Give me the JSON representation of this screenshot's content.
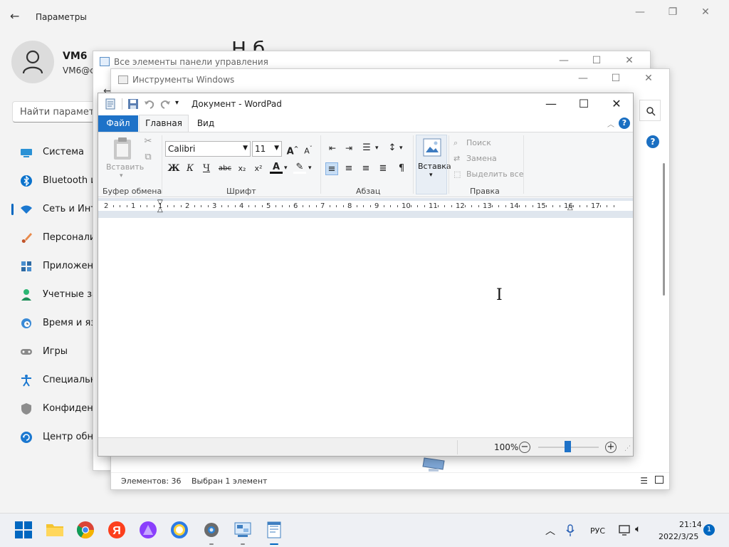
{
  "settings": {
    "title": "Параметры",
    "user_name": "VM6",
    "user_email": "VM6@c",
    "search_placeholder": "Найти параметр",
    "heading": "Н б",
    "nav": [
      {
        "label": "Система",
        "icon": "monitor-icon"
      },
      {
        "label": "Bluetooth и",
        "icon": "bluetooth-icon"
      },
      {
        "label": "Сеть и Инт",
        "icon": "wifi-icon",
        "active": true
      },
      {
        "label": "Персонали",
        "icon": "brush-icon"
      },
      {
        "label": "Приложен",
        "icon": "apps-icon"
      },
      {
        "label": "Учетные за",
        "icon": "person-icon"
      },
      {
        "label": "Время и яз",
        "icon": "clock-globe-icon"
      },
      {
        "label": "Игры",
        "icon": "gamepad-icon"
      },
      {
        "label": "Специальн",
        "icon": "accessibility-icon"
      },
      {
        "label": "Конфиден",
        "icon": "shield-icon"
      },
      {
        "label": "Центр обн",
        "icon": "update-icon"
      }
    ]
  },
  "control_panel": {
    "title": "Все элементы панели управления"
  },
  "windows_tools": {
    "title": "Инструменты Windows",
    "status_items": "Элементов: 36",
    "status_selected": "Выбран 1 элемент"
  },
  "wordpad": {
    "title": "Документ - WordPad",
    "tabs": {
      "file": "Файл",
      "home": "Главная",
      "view": "Вид"
    },
    "clipboard": {
      "paste": "Вставить",
      "group": "Буфер обмена"
    },
    "font": {
      "name": "Calibri",
      "size": "11",
      "group": "Шрифт",
      "bold": "Ж",
      "italic": "К",
      "underline": "Ч",
      "strike": "abc",
      "sub": "x₂",
      "sup": "x²",
      "color": "A"
    },
    "paragraph": {
      "group": "Абзац"
    },
    "insert": {
      "label": "Вставка",
      "group": ""
    },
    "editing": {
      "group": "Правка",
      "find": "Поиск",
      "replace": "Замена",
      "select_all": "Выделить все"
    },
    "ruler_labels": [
      "2",
      "1",
      "1",
      "2",
      "3",
      "4",
      "5",
      "6",
      "7",
      "8",
      "9",
      "10",
      "11",
      "12",
      "13",
      "14",
      "15",
      "16",
      "17"
    ],
    "zoom": "100%"
  },
  "taskbar": {
    "lang": "РУС",
    "time": "21:14",
    "date": "2022/3/25",
    "notifications": "1",
    "colors": {
      "accent": "#0067c0",
      "yandex": "#fc3f1d",
      "alice": "#8a3ffc"
    }
  }
}
